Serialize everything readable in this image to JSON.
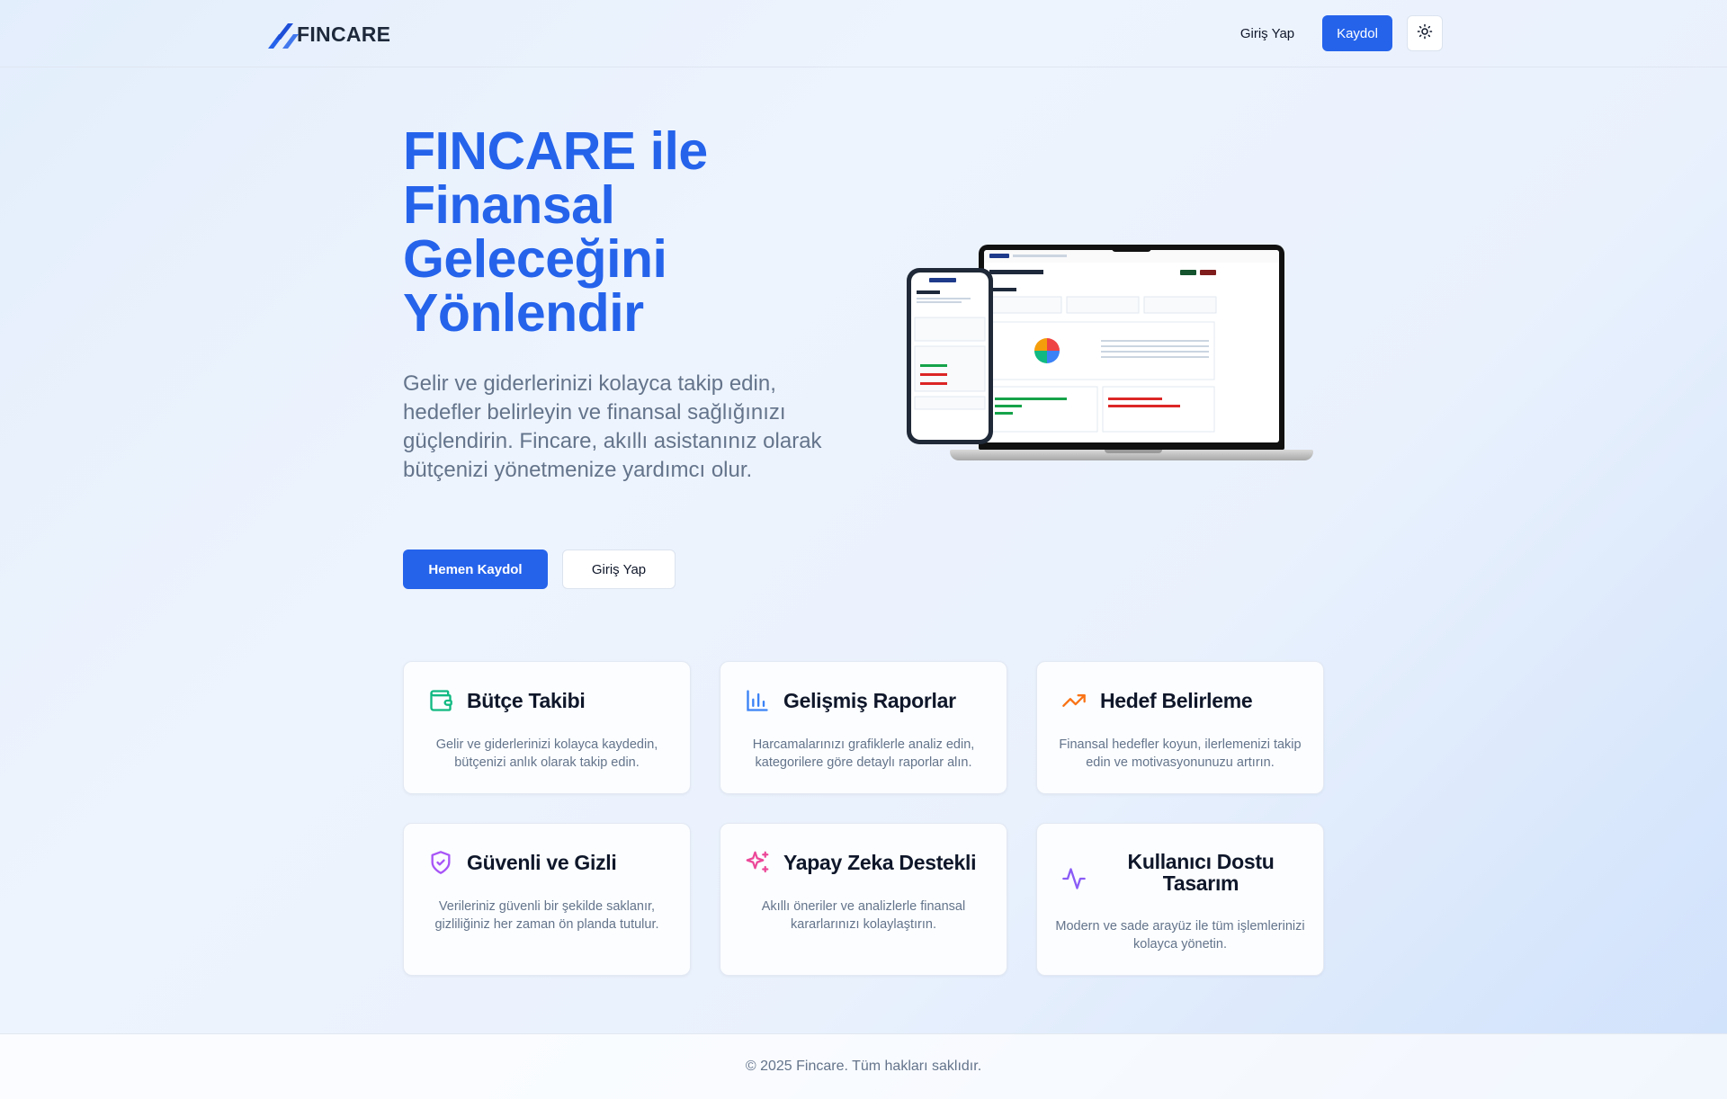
{
  "header": {
    "logo_text": "FINCARE",
    "login_label": "Giriş Yap",
    "signup_label": "Kaydol",
    "theme_icon": "sun-icon"
  },
  "hero": {
    "title_lines": [
      "FINCARE ile",
      "Finansal",
      "Geleceğini",
      "Yönlendir"
    ],
    "description": "Gelir ve giderlerinizi kolayca takip edin, hedefler belirleyin ve finansal sağlığınızı güçlendirin. Fincare, akıllı asistanınız olarak bütçenizi yönetmenize yardımcı olur.",
    "primary_button": "Hemen Kaydol",
    "secondary_button": "Giriş Yap"
  },
  "features": [
    {
      "icon": "wallet-icon",
      "color": "#10b981",
      "title": "Bütçe Takibi",
      "description": "Gelir ve giderlerinizi kolayca kaydedin, bütçenizi anlık olarak takip edin."
    },
    {
      "icon": "bar-chart-icon",
      "color": "#3b82f6",
      "title": "Gelişmiş Raporlar",
      "description": "Harcamalarınızı grafiklerle analiz edin, kategorilere göre detaylı raporlar alın."
    },
    {
      "icon": "trending-up-icon",
      "color": "#f97316",
      "title": "Hedef Belirleme",
      "description": "Finansal hedefler koyun, ilerlemenizi takip edin ve motivasyonunuzu artırın."
    },
    {
      "icon": "shield-check-icon",
      "color": "#a855f7",
      "title": "Güvenli ve Gizli",
      "description": "Verileriniz güvenli bir şekilde saklanır, gizliliğiniz her zaman ön planda tutulur."
    },
    {
      "icon": "sparkles-icon",
      "color": "#ec4899",
      "title": "Yapay Zeka Destekli",
      "description": "Akıllı öneriler ve analizlerle finansal kararlarınızı kolaylaştırın."
    },
    {
      "icon": "activity-icon",
      "color": "#8b5cf6",
      "title": "Kullanıcı Dostu Tasarım",
      "description": "Modern ve sade arayüz ile tüm işlemlerinizi kolayca yönetin."
    }
  ],
  "footer": {
    "text": "© 2025 Fincare. Tüm hakları saklıdır."
  },
  "colors": {
    "accent": "#2563eb"
  }
}
